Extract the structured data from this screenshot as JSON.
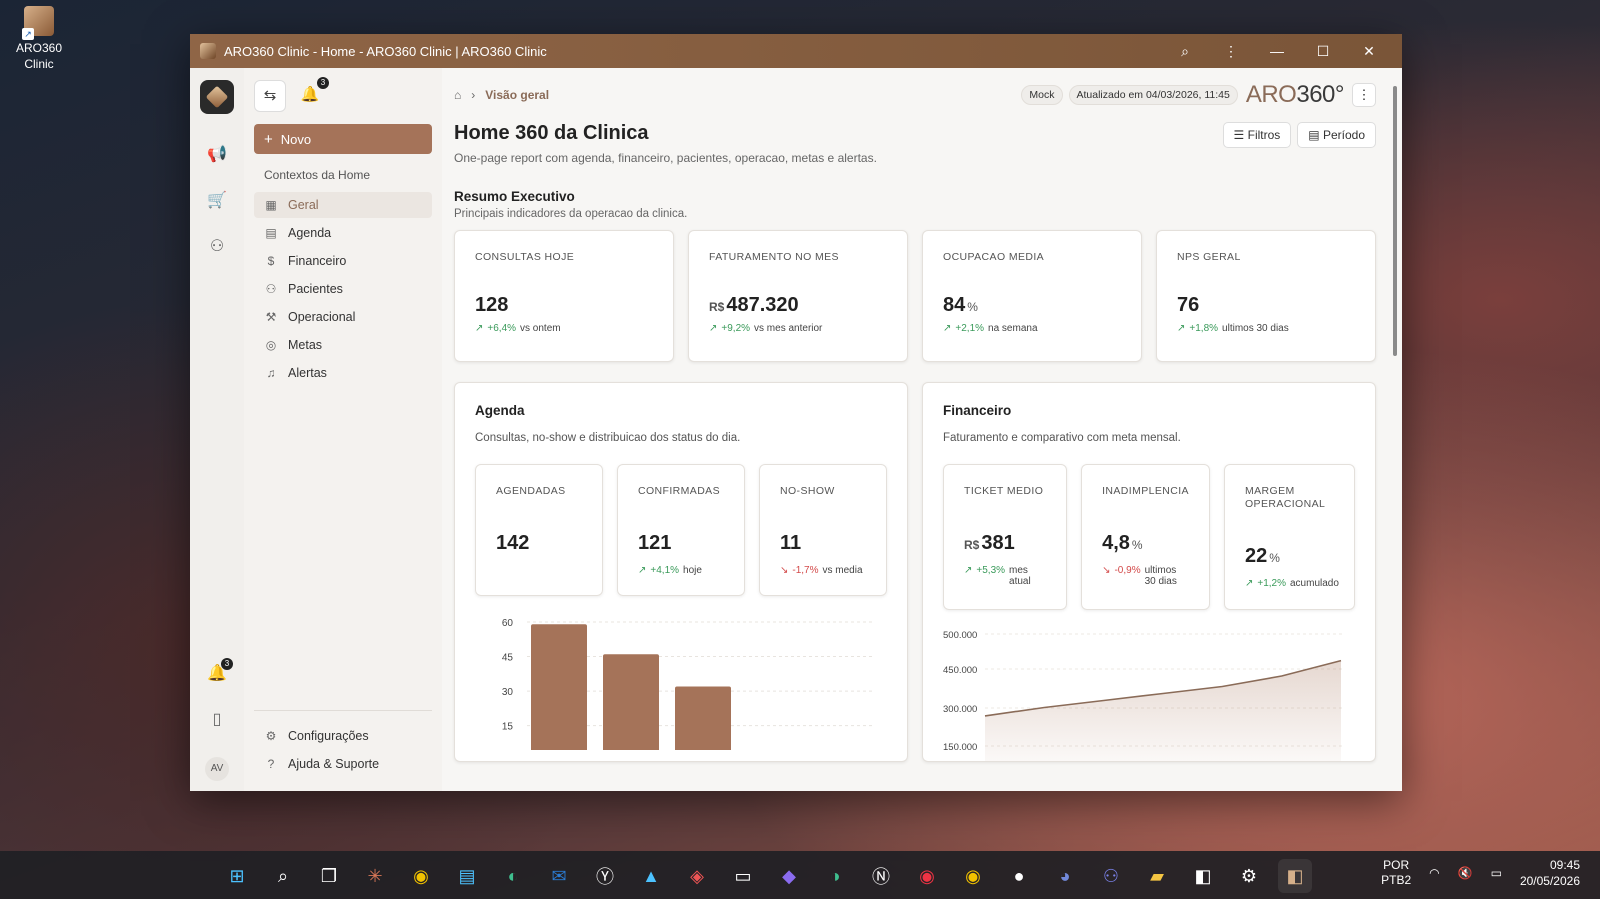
{
  "desktop": {
    "icon_label": "ARO360 Clinic"
  },
  "window": {
    "title": "ARO360 Clinic - Home - ARO360 Clinic | ARO360 Clinic"
  },
  "rail": {
    "notif_count": "3",
    "avatar": "AV"
  },
  "sidenav": {
    "notif_count": "3",
    "new_button": "Novo",
    "section_title": "Contextos da Home",
    "items": [
      {
        "label": "Geral",
        "icon": "grid-icon",
        "glyph": "▦"
      },
      {
        "label": "Agenda",
        "icon": "calendar-icon",
        "glyph": "▤"
      },
      {
        "label": "Financeiro",
        "icon": "dollar-icon",
        "glyph": "$"
      },
      {
        "label": "Pacientes",
        "icon": "users-icon",
        "glyph": "⚇"
      },
      {
        "label": "Operacional",
        "icon": "wrench-icon",
        "glyph": "⚒"
      },
      {
        "label": "Metas",
        "icon": "target-icon",
        "glyph": "◎"
      },
      {
        "label": "Alertas",
        "icon": "bell-icon",
        "glyph": "♫"
      }
    ],
    "settings": "Configurações",
    "help": "Ajuda & Suporte"
  },
  "topbar": {
    "breadcrumb_current": "Visão geral",
    "mock_pill": "Mock",
    "updated": "Atualizado em 04/03/2026, 11:45",
    "brand_a": "ARO",
    "brand_b": "360°"
  },
  "page": {
    "title": "Home 360 da Clinica",
    "subtitle": "One-page report com agenda, financeiro, pacientes, operacao, metas e alertas.",
    "filters": "Filtros",
    "period": "Período"
  },
  "summary": {
    "title": "Resumo Executivo",
    "subtitle": "Principais indicadores da operacao da clinica.",
    "kpis": [
      {
        "label": "CONSULTAS HOJE",
        "currency": "",
        "value": "128",
        "unit": "",
        "delta": "+6,4%",
        "note": "vs ontem"
      },
      {
        "label": "FATURAMENTO NO MES",
        "currency": "R$",
        "value": "487.320",
        "unit": "",
        "delta": "+9,2%",
        "note": "vs mes anterior"
      },
      {
        "label": "OCUPACAO MEDIA",
        "currency": "",
        "value": "84",
        "unit": "%",
        "delta": "+2,1%",
        "note": "na semana"
      },
      {
        "label": "NPS GERAL",
        "currency": "",
        "value": "76",
        "unit": "",
        "delta": "+1,8%",
        "note": "ultimos 30 dias"
      }
    ]
  },
  "agenda": {
    "title": "Agenda",
    "subtitle": "Consultas, no-show e distribuicao dos status do dia.",
    "cards": [
      {
        "label": "AGENDADAS",
        "value": "142",
        "delta": "",
        "note": ""
      },
      {
        "label": "CONFIRMADAS",
        "value": "121",
        "delta": "+4,1%",
        "note": "hoje"
      },
      {
        "label": "NO-SHOW",
        "value": "11",
        "delta": "-1,7%",
        "note": "vs media"
      }
    ]
  },
  "financeiro": {
    "title": "Financeiro",
    "subtitle": "Faturamento e comparativo com meta mensal.",
    "cards": [
      {
        "label": "TICKET MEDIO",
        "currency": "R$",
        "value": "381",
        "unit": "",
        "delta": "+5,3%",
        "note": "mes atual"
      },
      {
        "label": "INADIMPLENCIA",
        "currency": "",
        "value": "4,8",
        "unit": "%",
        "delta": "-0,9%",
        "note": "ultimos 30 dias"
      },
      {
        "label": "MARGEM OPERACIONAL",
        "currency": "",
        "value": "22",
        "unit": "%",
        "delta": "+1,2%",
        "note": "acumulado"
      }
    ]
  },
  "chart_data": [
    {
      "type": "bar",
      "title": "",
      "categories": [
        "",
        "",
        "",
        "",
        ""
      ],
      "values": [
        59,
        46,
        32,
        0,
        1
      ],
      "yticks": [
        "60",
        "45",
        "30",
        "15"
      ],
      "ylim": [
        0,
        60
      ],
      "color": "#a57359"
    },
    {
      "type": "area",
      "title": "",
      "x": [
        0,
        1,
        2,
        3,
        4,
        5,
        6
      ],
      "values": [
        383000,
        395000,
        405000,
        415000,
        425000,
        440000,
        462000
      ],
      "yticks": [
        "500.000",
        "450.000",
        "300.000",
        "150.000"
      ],
      "color": "#a57359"
    }
  ],
  "taskbar": {
    "lang_a": "POR",
    "lang_b": "PTB2",
    "time": "09:45",
    "date": "20/05/2026"
  }
}
